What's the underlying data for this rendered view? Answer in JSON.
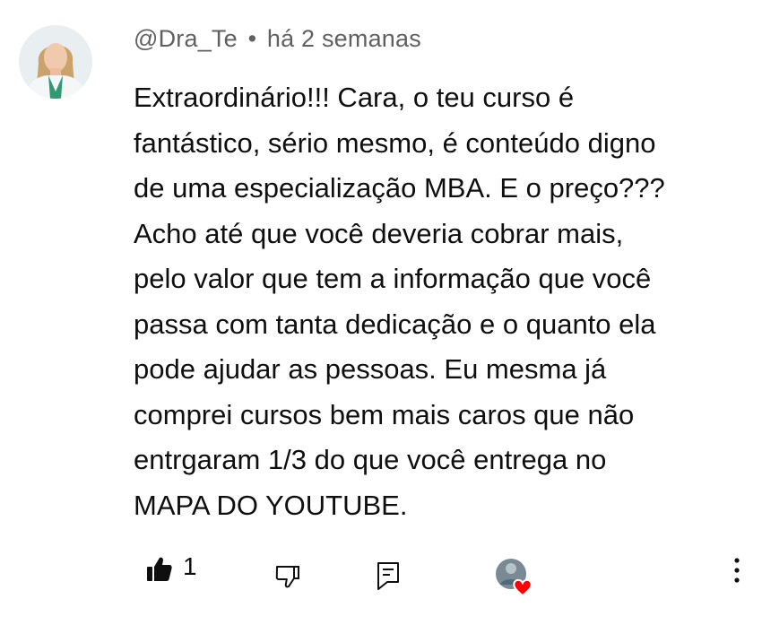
{
  "comment": {
    "author": "@Dra_Te",
    "separator": "•",
    "time": "há 2 semanas",
    "text": "Extraordinário!!! Cara, o teu curso é\nfantástico, sério mesmo, é conteúdo digno\nde uma especialização MBA. E o preço???\nAcho até que você deveria cobrar mais,\npelo valor que tem a informação que você\npassa com tanta dedicação e o quanto ela\npode ajudar as pessoas. Eu mesma já\ncomprei cursos bem mais caros que não\nentrgaram 1/3 do que você entrega no\nMAPA DO YOUTUBE.",
    "like_count": "1"
  },
  "icons": {
    "like": "thumbs-up-icon",
    "dislike": "thumbs-down-icon",
    "reply": "reply-comment-icon",
    "creator_heart": "creator-heart-icon",
    "more": "more-vertical-icon"
  },
  "colors": {
    "text": "#0f0f0f",
    "meta": "#606060",
    "heart": "#ff0000"
  }
}
